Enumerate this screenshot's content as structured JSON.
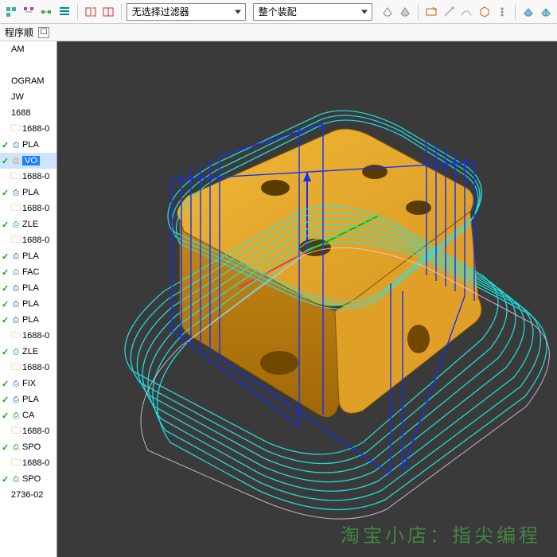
{
  "toolbar": {
    "filter_select": "无选择过滤器",
    "assembly_select": "整个装配"
  },
  "subbar": {
    "title": "程序顺"
  },
  "tree": {
    "items": [
      {
        "label": "AM",
        "check": false,
        "icon": "",
        "cls": ""
      },
      {
        "label": "",
        "check": false,
        "icon": "",
        "cls": ""
      },
      {
        "label": "OGRAM",
        "check": false,
        "icon": "",
        "cls": ""
      },
      {
        "label": "JW",
        "check": false,
        "icon": "",
        "cls": ""
      },
      {
        "label": "1688",
        "check": false,
        "icon": "",
        "cls": ""
      },
      {
        "label": "1688-0",
        "check": false,
        "icon": "folder",
        "cls": ""
      },
      {
        "label": "PLA",
        "check": true,
        "icon": "op",
        "cls": "blue"
      },
      {
        "label": "VO",
        "check": true,
        "icon": "op",
        "cls": "orange",
        "selected": true
      },
      {
        "label": "1688-0",
        "check": false,
        "icon": "folder",
        "cls": ""
      },
      {
        "label": "PLA",
        "check": true,
        "icon": "op",
        "cls": "blue"
      },
      {
        "label": "1688-0",
        "check": false,
        "icon": "folder",
        "cls": ""
      },
      {
        "label": "ZLE",
        "check": true,
        "icon": "op",
        "cls": "cyan"
      },
      {
        "label": "1688-0",
        "check": false,
        "icon": "folder",
        "cls": ""
      },
      {
        "label": "PLA",
        "check": true,
        "icon": "op",
        "cls": "blue"
      },
      {
        "label": "FAC",
        "check": true,
        "icon": "op",
        "cls": "gray"
      },
      {
        "label": "PLA",
        "check": true,
        "icon": "op",
        "cls": "blue"
      },
      {
        "label": "PLA",
        "check": true,
        "icon": "op",
        "cls": "blue"
      },
      {
        "label": "PLA",
        "check": true,
        "icon": "op",
        "cls": "blue"
      },
      {
        "label": "1688-0",
        "check": false,
        "icon": "folder",
        "cls": ""
      },
      {
        "label": "ZLE",
        "check": true,
        "icon": "op",
        "cls": "cyan"
      },
      {
        "label": "1688-0",
        "check": false,
        "icon": "folder",
        "cls": ""
      },
      {
        "label": "FIX",
        "check": true,
        "icon": "op",
        "cls": "purple"
      },
      {
        "label": "PLA",
        "check": true,
        "icon": "op",
        "cls": "blue"
      },
      {
        "label": "CA",
        "check": true,
        "icon": "op",
        "cls": "green"
      },
      {
        "label": "1688-0",
        "check": false,
        "icon": "folder",
        "cls": ""
      },
      {
        "label": "SPO",
        "check": true,
        "icon": "op",
        "cls": "green"
      },
      {
        "label": "1688-0",
        "check": false,
        "icon": "folder",
        "cls": ""
      },
      {
        "label": "SPO",
        "check": true,
        "icon": "op",
        "cls": "green"
      },
      {
        "label": "2736-02",
        "check": false,
        "icon": "",
        "cls": ""
      }
    ]
  },
  "watermark": "淘宝小店：指尖编程"
}
